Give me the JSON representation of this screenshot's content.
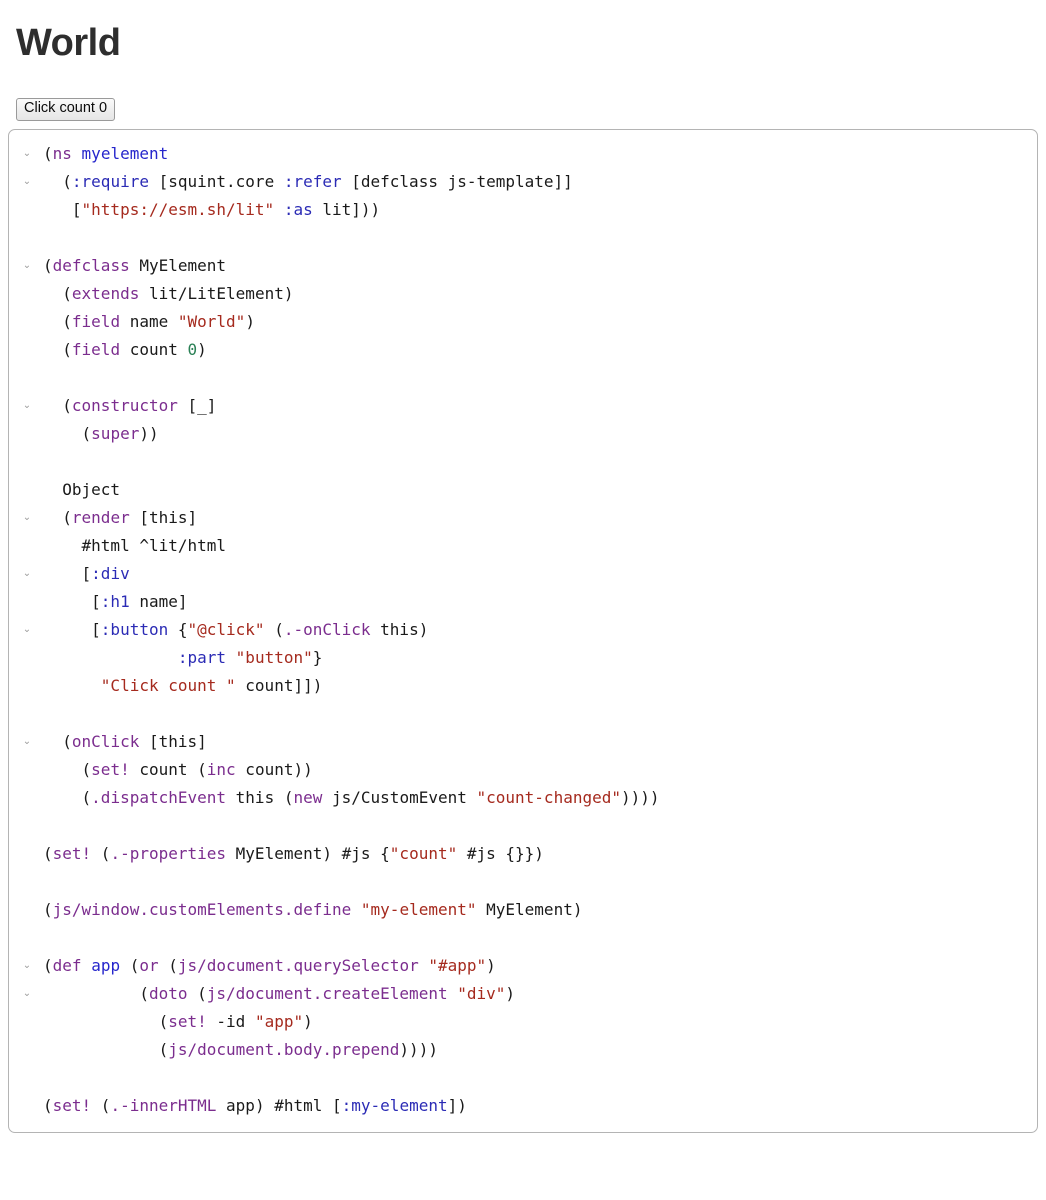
{
  "page": {
    "heading": "World"
  },
  "counter": {
    "button_label": "Click count 0",
    "label_prefix": "Click count ",
    "count": 0
  },
  "theme": {
    "background": "#ffffff",
    "heading_color": "#2e2e2e",
    "editor_border": "#b4b4b4",
    "button_border": "#9a9a9a",
    "fold_marker_color": "#9b9b9b",
    "token_definition": "#7b2d8e",
    "token_symbol_name": "#2626cc",
    "token_keyword": "#2b2bb5",
    "token_string": "#a52a1e",
    "token_number": "#2a8055",
    "token_plain": "#1a1a1a"
  },
  "editor": {
    "fold_marker_glyph": "⌄",
    "language": "clojure",
    "lines": [
      {
        "fold": true,
        "tokens": [
          {
            "t": "plain",
            "v": "("
          },
          {
            "t": "def",
            "v": "ns"
          },
          {
            "t": "plain",
            "v": " "
          },
          {
            "t": "name",
            "v": "myelement"
          }
        ]
      },
      {
        "fold": true,
        "tokens": [
          {
            "t": "plain",
            "v": "  ("
          },
          {
            "t": "kw",
            "v": ":require"
          },
          {
            "t": "plain",
            "v": " [squint.core "
          },
          {
            "t": "kw",
            "v": ":refer"
          },
          {
            "t": "plain",
            "v": " [defclass js-template]]"
          }
        ]
      },
      {
        "fold": false,
        "tokens": [
          {
            "t": "plain",
            "v": "   ["
          },
          {
            "t": "str",
            "v": "\"https://esm.sh/lit\""
          },
          {
            "t": "plain",
            "v": " "
          },
          {
            "t": "kw",
            "v": ":as"
          },
          {
            "t": "plain",
            "v": " lit]))"
          }
        ]
      },
      {
        "fold": false,
        "tokens": []
      },
      {
        "fold": true,
        "tokens": [
          {
            "t": "plain",
            "v": "("
          },
          {
            "t": "def",
            "v": "defclass"
          },
          {
            "t": "plain",
            "v": " MyElement"
          }
        ]
      },
      {
        "fold": false,
        "tokens": [
          {
            "t": "plain",
            "v": "  ("
          },
          {
            "t": "def",
            "v": "extends"
          },
          {
            "t": "plain",
            "v": " lit/LitElement)"
          }
        ]
      },
      {
        "fold": false,
        "tokens": [
          {
            "t": "plain",
            "v": "  ("
          },
          {
            "t": "def",
            "v": "field"
          },
          {
            "t": "plain",
            "v": " name "
          },
          {
            "t": "str",
            "v": "\"World\""
          },
          {
            "t": "plain",
            "v": ")"
          }
        ]
      },
      {
        "fold": false,
        "tokens": [
          {
            "t": "plain",
            "v": "  ("
          },
          {
            "t": "def",
            "v": "field"
          },
          {
            "t": "plain",
            "v": " count "
          },
          {
            "t": "num",
            "v": "0"
          },
          {
            "t": "plain",
            "v": ")"
          }
        ]
      },
      {
        "fold": false,
        "tokens": []
      },
      {
        "fold": true,
        "tokens": [
          {
            "t": "plain",
            "v": "  ("
          },
          {
            "t": "def",
            "v": "constructor"
          },
          {
            "t": "plain",
            "v": " [_]"
          }
        ]
      },
      {
        "fold": false,
        "tokens": [
          {
            "t": "plain",
            "v": "    ("
          },
          {
            "t": "def",
            "v": "super"
          },
          {
            "t": "plain",
            "v": "))"
          }
        ]
      },
      {
        "fold": false,
        "tokens": []
      },
      {
        "fold": false,
        "tokens": [
          {
            "t": "plain",
            "v": "  Object"
          }
        ]
      },
      {
        "fold": true,
        "tokens": [
          {
            "t": "plain",
            "v": "  ("
          },
          {
            "t": "def",
            "v": "render"
          },
          {
            "t": "plain",
            "v": " [this]"
          }
        ]
      },
      {
        "fold": false,
        "tokens": [
          {
            "t": "plain",
            "v": "    #html ^lit/html"
          }
        ]
      },
      {
        "fold": true,
        "tokens": [
          {
            "t": "plain",
            "v": "    ["
          },
          {
            "t": "kw",
            "v": ":div"
          }
        ]
      },
      {
        "fold": false,
        "tokens": [
          {
            "t": "plain",
            "v": "     ["
          },
          {
            "t": "kw",
            "v": ":h1"
          },
          {
            "t": "plain",
            "v": " name]"
          }
        ]
      },
      {
        "fold": true,
        "tokens": [
          {
            "t": "plain",
            "v": "     ["
          },
          {
            "t": "kw",
            "v": ":button"
          },
          {
            "t": "plain",
            "v": " {"
          },
          {
            "t": "str",
            "v": "\"@click\""
          },
          {
            "t": "plain",
            "v": " ("
          },
          {
            "t": "def",
            "v": ".-onClick"
          },
          {
            "t": "plain",
            "v": " this)"
          }
        ]
      },
      {
        "fold": false,
        "tokens": [
          {
            "t": "plain",
            "v": "              "
          },
          {
            "t": "kw",
            "v": ":part"
          },
          {
            "t": "plain",
            "v": " "
          },
          {
            "t": "str",
            "v": "\"button\""
          },
          {
            "t": "plain",
            "v": "}"
          }
        ]
      },
      {
        "fold": false,
        "tokens": [
          {
            "t": "plain",
            "v": "      "
          },
          {
            "t": "str",
            "v": "\"Click count \""
          },
          {
            "t": "plain",
            "v": " count]])"
          }
        ]
      },
      {
        "fold": false,
        "tokens": []
      },
      {
        "fold": true,
        "tokens": [
          {
            "t": "plain",
            "v": "  ("
          },
          {
            "t": "def",
            "v": "onClick"
          },
          {
            "t": "plain",
            "v": " [this]"
          }
        ]
      },
      {
        "fold": false,
        "tokens": [
          {
            "t": "plain",
            "v": "    ("
          },
          {
            "t": "def",
            "v": "set!"
          },
          {
            "t": "plain",
            "v": " count ("
          },
          {
            "t": "def",
            "v": "inc"
          },
          {
            "t": "plain",
            "v": " count))"
          }
        ]
      },
      {
        "fold": false,
        "tokens": [
          {
            "t": "plain",
            "v": "    ("
          },
          {
            "t": "def",
            "v": ".dispatchEvent"
          },
          {
            "t": "plain",
            "v": " this ("
          },
          {
            "t": "def",
            "v": "new"
          },
          {
            "t": "plain",
            "v": " js/CustomEvent "
          },
          {
            "t": "str",
            "v": "\"count-changed\""
          },
          {
            "t": "plain",
            "v": "))))"
          }
        ]
      },
      {
        "fold": false,
        "tokens": []
      },
      {
        "fold": false,
        "tokens": [
          {
            "t": "plain",
            "v": "("
          },
          {
            "t": "def",
            "v": "set!"
          },
          {
            "t": "plain",
            "v": " ("
          },
          {
            "t": "def",
            "v": ".-properties"
          },
          {
            "t": "plain",
            "v": " MyElement) #js {"
          },
          {
            "t": "str",
            "v": "\"count\""
          },
          {
            "t": "plain",
            "v": " #js {}})"
          }
        ]
      },
      {
        "fold": false,
        "tokens": []
      },
      {
        "fold": false,
        "tokens": [
          {
            "t": "plain",
            "v": "("
          },
          {
            "t": "def",
            "v": "js/window.customElements.define"
          },
          {
            "t": "plain",
            "v": " "
          },
          {
            "t": "str",
            "v": "\"my-element\""
          },
          {
            "t": "plain",
            "v": " MyElement)"
          }
        ]
      },
      {
        "fold": false,
        "tokens": []
      },
      {
        "fold": true,
        "tokens": [
          {
            "t": "plain",
            "v": "("
          },
          {
            "t": "def",
            "v": "def"
          },
          {
            "t": "plain",
            "v": " "
          },
          {
            "t": "name",
            "v": "app"
          },
          {
            "t": "plain",
            "v": " ("
          },
          {
            "t": "def",
            "v": "or"
          },
          {
            "t": "plain",
            "v": " ("
          },
          {
            "t": "def",
            "v": "js/document.querySelector"
          },
          {
            "t": "plain",
            "v": " "
          },
          {
            "t": "str",
            "v": "\"#app\""
          },
          {
            "t": "plain",
            "v": ")"
          }
        ]
      },
      {
        "fold": true,
        "tokens": [
          {
            "t": "plain",
            "v": "          ("
          },
          {
            "t": "def",
            "v": "doto"
          },
          {
            "t": "plain",
            "v": " ("
          },
          {
            "t": "def",
            "v": "js/document.createElement"
          },
          {
            "t": "plain",
            "v": " "
          },
          {
            "t": "str",
            "v": "\"div\""
          },
          {
            "t": "plain",
            "v": ")"
          }
        ]
      },
      {
        "fold": false,
        "tokens": [
          {
            "t": "plain",
            "v": "            ("
          },
          {
            "t": "def",
            "v": "set!"
          },
          {
            "t": "plain",
            "v": " -id "
          },
          {
            "t": "str",
            "v": "\"app\""
          },
          {
            "t": "plain",
            "v": ")"
          }
        ]
      },
      {
        "fold": false,
        "tokens": [
          {
            "t": "plain",
            "v": "            ("
          },
          {
            "t": "def",
            "v": "js/document.body.prepend"
          },
          {
            "t": "plain",
            "v": "))))"
          }
        ]
      },
      {
        "fold": false,
        "tokens": []
      },
      {
        "fold": false,
        "tokens": [
          {
            "t": "plain",
            "v": "("
          },
          {
            "t": "def",
            "v": "set!"
          },
          {
            "t": "plain",
            "v": " ("
          },
          {
            "t": "def",
            "v": ".-innerHTML"
          },
          {
            "t": "plain",
            "v": " app) #html ["
          },
          {
            "t": "kw",
            "v": ":my-element"
          },
          {
            "t": "plain",
            "v": "])"
          }
        ]
      }
    ]
  }
}
